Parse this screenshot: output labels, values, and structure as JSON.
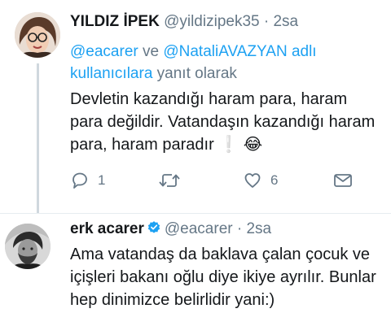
{
  "tweets": [
    {
      "name": "YILDIZ İPEK",
      "handle": "@yildizipek35",
      "time": "· 2sa",
      "reply_prefix_1": "@eacarer",
      "reply_and": " ve ",
      "reply_prefix_2": "@NataliAVAZYAN",
      "reply_suffix_link": "adlı kullanıcılara",
      "reply_suffix": " yanıt olarak",
      "text": "Devletin kazandığı haram para, haram para değildir. Vatandaşın kazandığı haram para, haram paradır",
      "emoji_1": "❕",
      "emoji_2": "😂",
      "reply_count": "1",
      "retweet_count": "",
      "like_count": "6"
    },
    {
      "name": "erk acarer",
      "handle": "@eacarer",
      "time": "· 2sa",
      "text": "Ama vatandaş da baklava çalan çocuk ve içişleri bakanı oğlu diye ikiye ayrılır. Bunlar hep dinimizce belirlidir yani:)"
    }
  ],
  "icons": {
    "reply": "reply-icon",
    "retweet": "retweet-icon",
    "like": "heart-icon",
    "share": "mail-icon",
    "verified": "verified-badge-icon"
  },
  "colors": {
    "link": "#1da1f2",
    "muted": "#657786",
    "verified": "#1da1f2"
  }
}
